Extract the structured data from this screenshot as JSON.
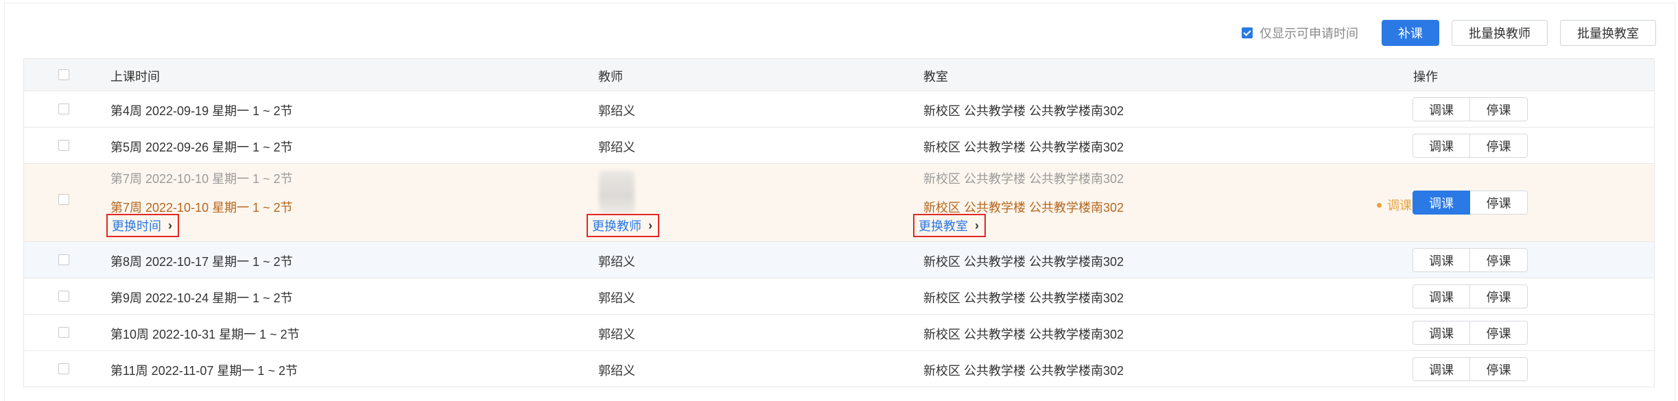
{
  "toolbar": {
    "only_applicable_label": "仅显示可申请时间",
    "only_applicable_checked": true,
    "makeup_button": "补课",
    "batch_teacher_button": "批量换教师",
    "batch_room_button": "批量换教室"
  },
  "table": {
    "headers": {
      "time": "上课时间",
      "teacher": "教师",
      "room": "教室",
      "op": "操作"
    },
    "rows": [
      {
        "time": "第4周 2022-09-19 星期一 1 ~ 2节",
        "teacher": "郭绍义",
        "room": "新校区 公共教学楼 公共教学楼南302",
        "adjust": "调课",
        "stop": "停课"
      },
      {
        "time": "第5周 2022-09-26 星期一 1 ~ 2节",
        "teacher": "郭绍义",
        "room": "新校区 公共教学楼 公共教学楼南302",
        "adjust": "调课",
        "stop": "停课"
      },
      {
        "time": "第8周 2022-10-17 星期一 1 ~ 2节",
        "teacher": "郭绍义",
        "room": "新校区 公共教学楼 公共教学楼南302",
        "adjust": "调课",
        "stop": "停课"
      },
      {
        "time": "第9周 2022-10-24 星期一 1 ~ 2节",
        "teacher": "郭绍义",
        "room": "新校区 公共教学楼 公共教学楼南302",
        "adjust": "调课",
        "stop": "停课"
      },
      {
        "time": "第10周 2022-10-31 星期一 1 ~ 2节",
        "teacher": "郭绍义",
        "room": "新校区 公共教学楼 公共教学楼南302",
        "adjust": "调课",
        "stop": "停课"
      },
      {
        "time": "第11周 2022-11-07 星期一 1 ~ 2节",
        "teacher": "郭绍义",
        "room": "新校区 公共教学楼 公共教学楼南302",
        "adjust": "调课",
        "stop": "停课"
      }
    ],
    "expanded_row": {
      "old_time": "第7周 2022-10-10 星期一 1 ~ 2节",
      "new_time": "第7周 2022-10-10 星期一 1 ~ 2节",
      "change_time_link": "更换时间",
      "change_teacher_link": "更换教师",
      "old_room": "新校区 公共教学楼 公共教学楼南302",
      "new_room": "新校区 公共教学楼 公共教学楼南302",
      "change_room_link": "更换教室",
      "status": "调课",
      "adjust": "调课",
      "stop": "停课"
    }
  },
  "colors": {
    "primary": "#2a79e4",
    "highlight_border": "#e02828",
    "changed_text": "#b4671e",
    "status": "#e8a23e"
  }
}
